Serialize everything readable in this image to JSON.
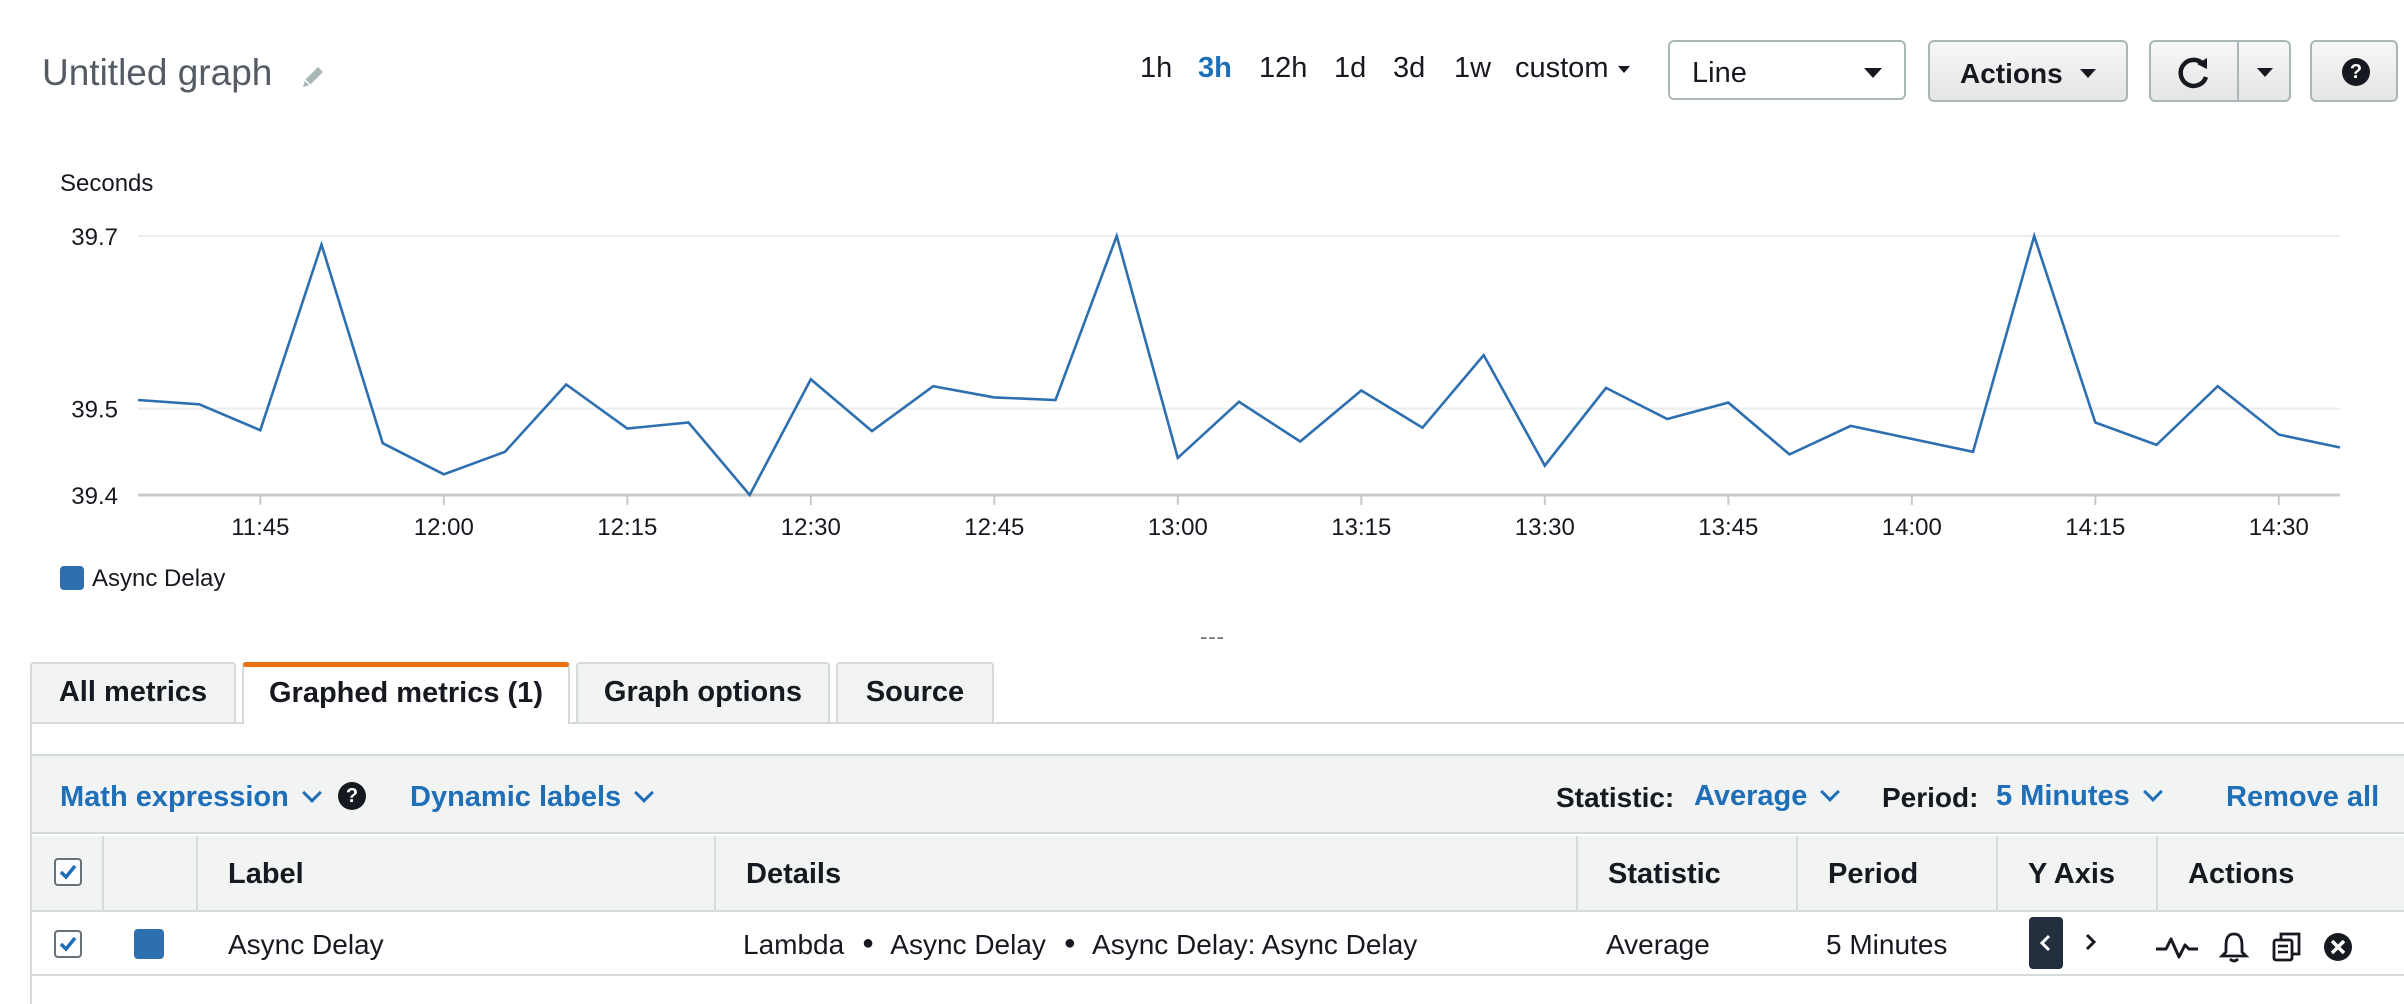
{
  "header": {
    "title": "Untitled graph",
    "time_ranges": [
      "1h",
      "3h",
      "12h",
      "1d",
      "3d",
      "1w"
    ],
    "active_range": "3h",
    "custom_label": "custom",
    "view_select": "Line",
    "actions_label": "Actions",
    "help_glyph": "?"
  },
  "icons": {
    "edit": "pencil-icon",
    "refresh": "refresh-icon",
    "help": "help-icon"
  },
  "chart_data": {
    "type": "line",
    "ylabel": "Seconds",
    "ylim": [
      39.4,
      39.7
    ],
    "yticks": [
      "39.7",
      "39.5",
      "39.4"
    ],
    "ytick_values": [
      39.7,
      39.5,
      39.4
    ],
    "xticks": [
      "11:45",
      "12:00",
      "12:15",
      "12:30",
      "12:45",
      "13:00",
      "13:15",
      "13:30",
      "13:45",
      "14:00",
      "14:15",
      "14:30"
    ],
    "x": [
      "11:35",
      "11:40",
      "11:45",
      "11:50",
      "11:55",
      "12:00",
      "12:05",
      "12:10",
      "12:15",
      "12:20",
      "12:25",
      "12:30",
      "12:35",
      "12:40",
      "12:45",
      "12:50",
      "12:55",
      "13:00",
      "13:05",
      "13:10",
      "13:15",
      "13:20",
      "13:25",
      "13:30",
      "13:35",
      "13:40",
      "13:45",
      "13:50",
      "13:55",
      "14:00",
      "14:05",
      "14:10",
      "14:15",
      "14:20",
      "14:25",
      "14:30",
      "14:35"
    ],
    "series": [
      {
        "name": "Async Delay",
        "color": "#2e6fb0",
        "values": [
          39.51,
          39.505,
          39.475,
          39.69,
          39.46,
          39.424,
          39.45,
          39.528,
          39.477,
          39.484,
          39.4,
          39.534,
          39.474,
          39.526,
          39.513,
          39.51,
          39.7,
          39.443,
          39.508,
          39.462,
          39.521,
          39.478,
          39.562,
          39.434,
          39.524,
          39.488,
          39.507,
          39.447,
          39.48,
          39.465,
          39.45,
          39.7,
          39.484,
          39.458,
          39.526,
          39.47,
          39.455
        ]
      }
    ],
    "grid": true,
    "legend": "bottom-left"
  },
  "tabs": [
    "All metrics",
    "Graphed metrics (1)",
    "Graph options",
    "Source"
  ],
  "active_tab": "Graphed metrics (1)",
  "toolbar": {
    "math_expression": "Math expression",
    "dynamic_labels": "Dynamic labels",
    "statistic_label": "Statistic:",
    "statistic_value": "Average",
    "period_label": "Period:",
    "period_value": "5 Minutes",
    "remove_all": "Remove all"
  },
  "table": {
    "headers": [
      "Label",
      "Details",
      "Statistic",
      "Period",
      "Y Axis",
      "Actions"
    ],
    "rows": [
      {
        "label": "Async Delay",
        "details": [
          "Lambda",
          "Async Delay",
          "Async Delay: Async Delay"
        ],
        "statistic": "Average",
        "period": "5 Minutes",
        "color": "#2e6fb0",
        "checked": true
      }
    ]
  },
  "handle_text": "---"
}
